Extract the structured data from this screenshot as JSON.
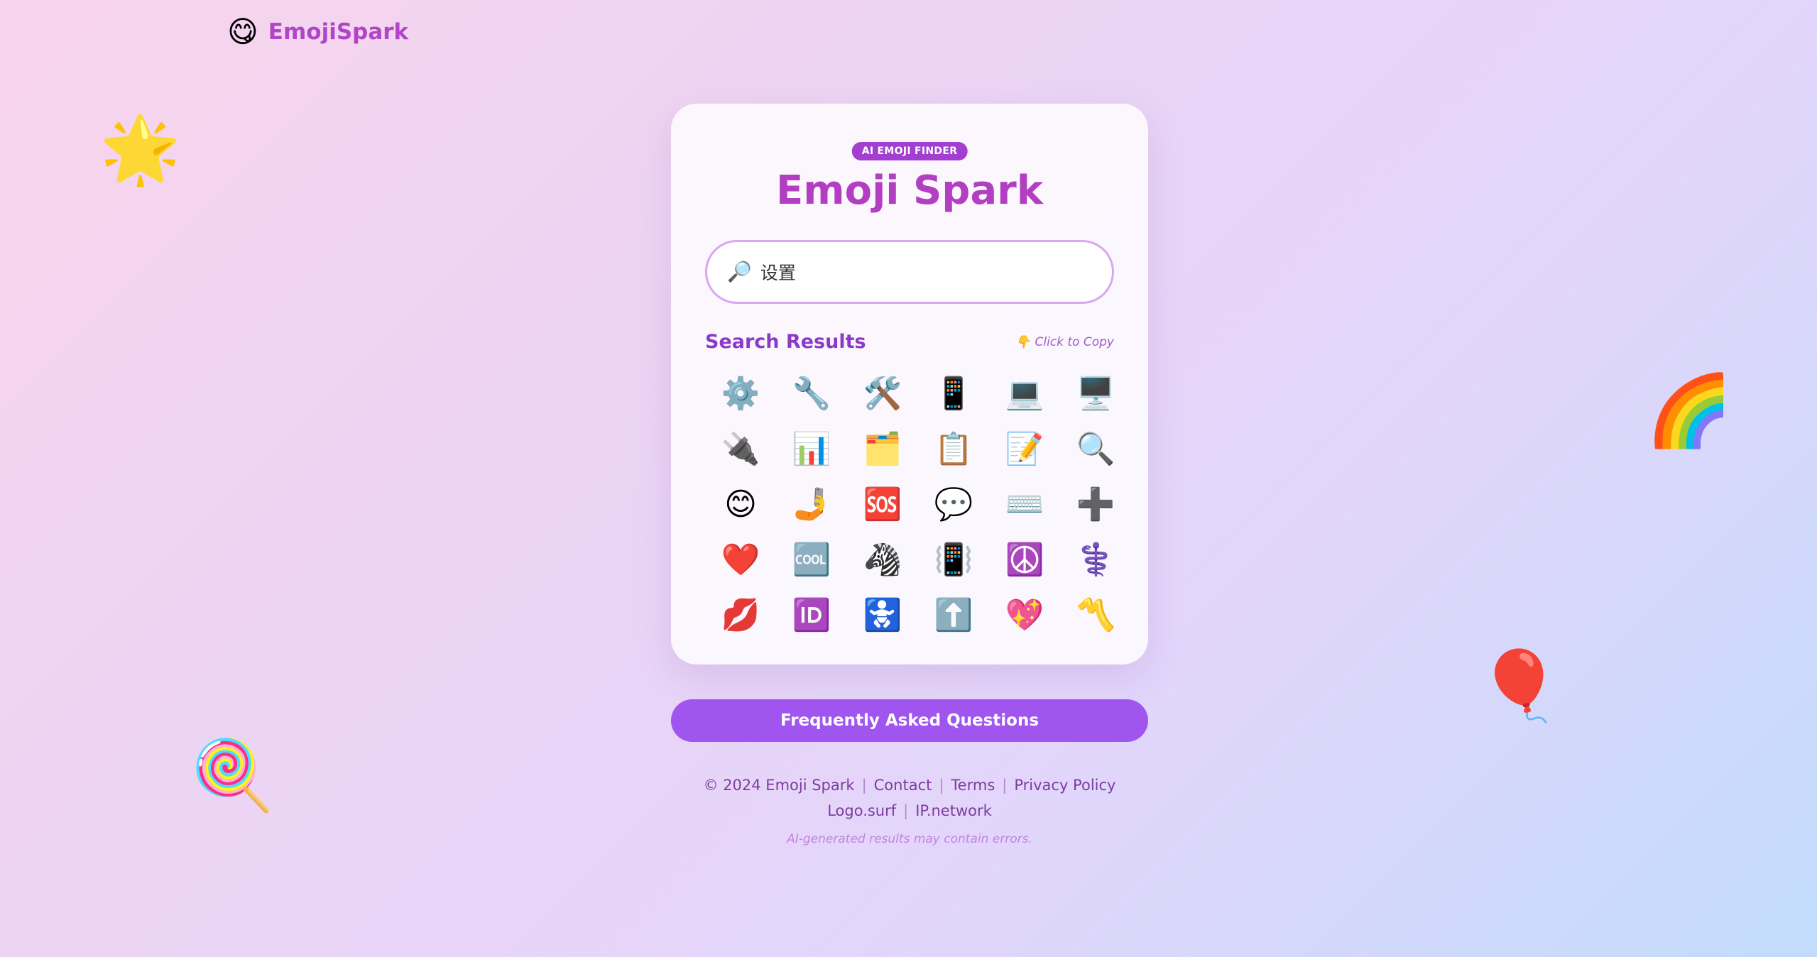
{
  "header": {
    "logo_icon": "😋",
    "brand_name": "EmojiSpark"
  },
  "decorations": {
    "star": "🌟",
    "rainbow": "🌈",
    "balloon": "🎈",
    "lollipop": "🍭"
  },
  "card": {
    "badge": "AI EMOJI FINDER",
    "title": "Emoji Spark",
    "search": {
      "icon": "🔎",
      "value": "设置"
    },
    "results_title": "Search Results",
    "copy_hint_icon": "👇",
    "copy_hint": "Click to Copy",
    "results": [
      "⚙️",
      "🔧",
      "🛠️",
      "📱",
      "💻",
      "🖥️",
      "🔌",
      "📊",
      "🗂️",
      "📋",
      "📝",
      "🔍",
      "😊",
      "🤳",
      "🆘",
      "💬",
      "⌨️",
      "➕",
      "❤️",
      "🆒",
      "🦓",
      "📳",
      "☮️",
      "⚕️",
      "💋",
      "🆔",
      "🚼",
      "⬆️",
      "💖",
      "〽️"
    ]
  },
  "faq_button": "Frequently Asked Questions",
  "footer": {
    "copyright": "© 2024 Emoji Spark",
    "contact": "Contact",
    "terms": "Terms",
    "privacy": "Privacy Policy",
    "logo_surf": "Logo.surf",
    "ip_network": "IP.network",
    "disclaimer": "AI-generated results may contain errors."
  },
  "colors": {
    "accent": "#a155ef",
    "title": "#b23ec2",
    "badge": "#a23fd1"
  }
}
